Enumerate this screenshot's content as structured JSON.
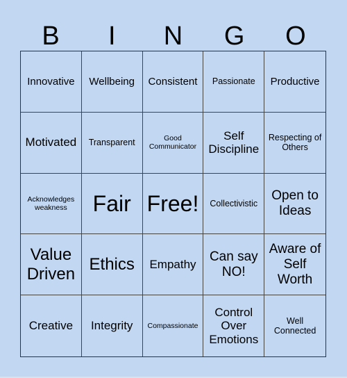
{
  "header": [
    "B",
    "I",
    "N",
    "G",
    "O"
  ],
  "cells": [
    {
      "text": "Innovative",
      "size": "s3"
    },
    {
      "text": "Wellbeing",
      "size": "s3"
    },
    {
      "text": "Consistent",
      "size": "s3"
    },
    {
      "text": "Passionate",
      "size": "s2"
    },
    {
      "text": "Productive",
      "size": "s3"
    },
    {
      "text": "Motivated",
      "size": "s4"
    },
    {
      "text": "Transparent",
      "size": "s2"
    },
    {
      "text": "Good Communicator",
      "size": "s1"
    },
    {
      "text": "Self Discipline",
      "size": "s4"
    },
    {
      "text": "Respecting of Others",
      "size": "s2"
    },
    {
      "text": "Acknowledges weakness",
      "size": "s1"
    },
    {
      "text": "Fair",
      "size": "s7"
    },
    {
      "text": "Free!",
      "size": "s7"
    },
    {
      "text": "Collectivistic",
      "size": "s2"
    },
    {
      "text": "Open to Ideas",
      "size": "s5"
    },
    {
      "text": "Value Driven",
      "size": "s6"
    },
    {
      "text": "Ethics",
      "size": "s6"
    },
    {
      "text": "Empathy",
      "size": "s4"
    },
    {
      "text": "Can say NO!",
      "size": "s5"
    },
    {
      "text": "Aware of Self Worth",
      "size": "s5"
    },
    {
      "text": "Creative",
      "size": "s4"
    },
    {
      "text": "Integrity",
      "size": "s4"
    },
    {
      "text": "Compassionate",
      "size": "s1"
    },
    {
      "text": "Control Over Emotions",
      "size": "s4"
    },
    {
      "text": "Well Connected",
      "size": "s2"
    }
  ]
}
